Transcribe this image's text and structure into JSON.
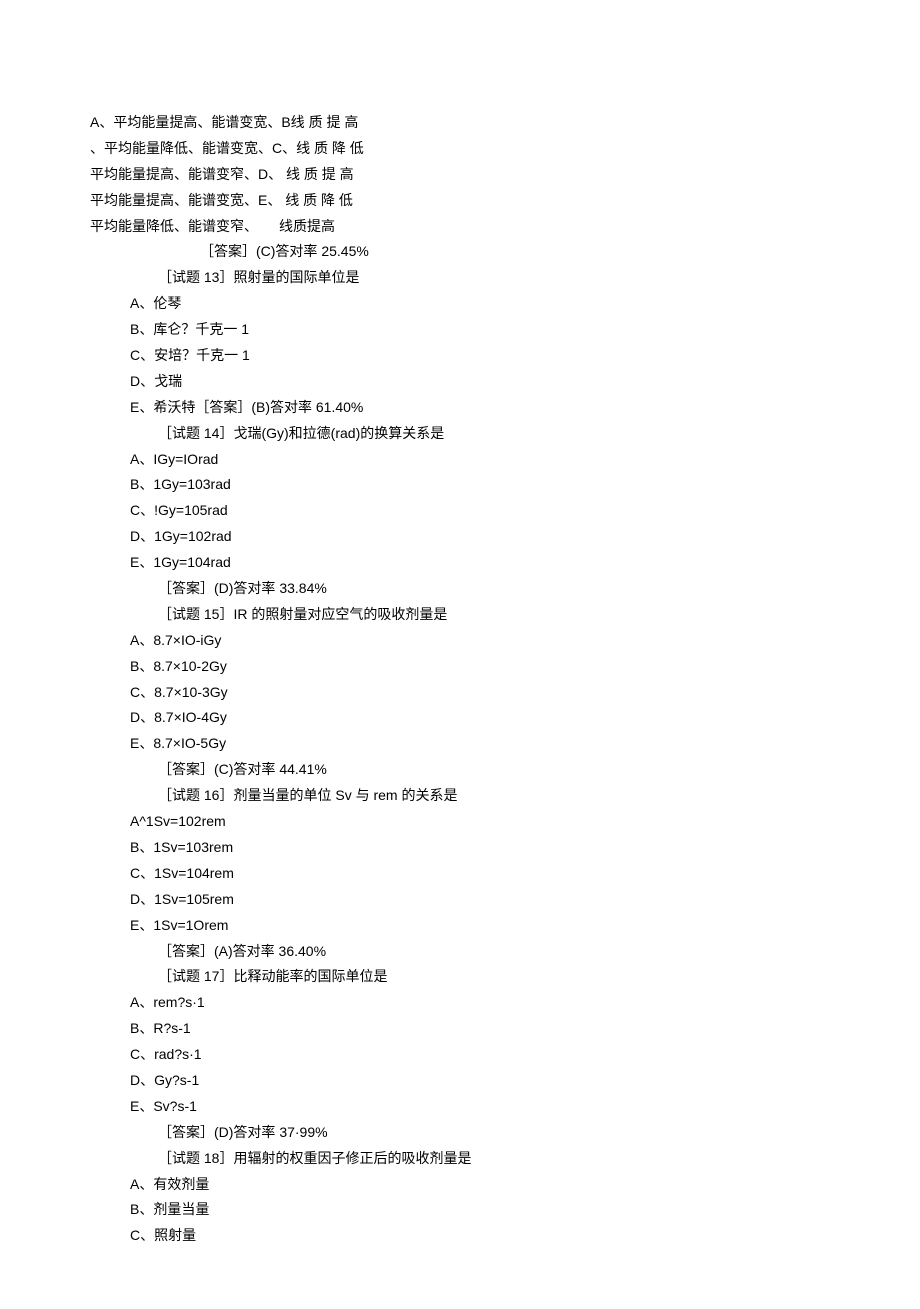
{
  "lines": [
    {
      "cls": "indent0",
      "text": "A、平均能量提高、能谱变宽、B线 质 提 高"
    },
    {
      "cls": "indent0",
      "text": "、平均能量降低、能谱变宽、C、线 质 降 低"
    },
    {
      "cls": "indent0",
      "text": "平均能量提高、能谱变窄、D、 线 质 提 高"
    },
    {
      "cls": "indent0",
      "text": "平均能量提高、能谱变宽、E、 线 质 降 低"
    },
    {
      "cls": "indent0",
      "text": "平均能量降低、能谱变窄、　　线质提高"
    },
    {
      "cls": "indent3",
      "text": "［答案］(C)答对率 25.45%"
    },
    {
      "cls": "indent2",
      "text": "［试题 13］照射量的国际单位是"
    },
    {
      "cls": "indent1",
      "text": "A、伦琴"
    },
    {
      "cls": "indent1",
      "text": "B、库仑？千克一 1"
    },
    {
      "cls": "indent1",
      "text": "C、安培？千克一 1"
    },
    {
      "cls": "indent1",
      "text": "D、戈瑞"
    },
    {
      "cls": "indent1",
      "text": "E、希沃特［答案］(B)答对率 61.40%"
    },
    {
      "cls": "indent2",
      "text": "［试题 14］戈瑞(Gy)和拉德(rad)的换算关系是"
    },
    {
      "cls": "indent1",
      "text": "A、IGy=IOrad"
    },
    {
      "cls": "indent1",
      "text": "B、1Gy=103rad"
    },
    {
      "cls": "indent1",
      "text": "C、!Gy=105rad"
    },
    {
      "cls": "indent1",
      "text": "D、1Gy=102rad"
    },
    {
      "cls": "indent1",
      "text": "E、1Gy=104rad"
    },
    {
      "cls": "indent2",
      "text": "［答案］(D)答对率 33.84%"
    },
    {
      "cls": "indent2",
      "text": "［试题 15］IR 的照射量对应空气的吸收剂量是"
    },
    {
      "cls": "indent1",
      "text": "A、8.7×IO-iGy"
    },
    {
      "cls": "indent1",
      "text": "B、8.7×10-2Gy"
    },
    {
      "cls": "indent1",
      "text": "C、8.7×10-3Gy"
    },
    {
      "cls": "indent1",
      "text": "D、8.7×IO-4Gy"
    },
    {
      "cls": "indent1",
      "text": "E、8.7×IO-5Gy"
    },
    {
      "cls": "indent2",
      "text": "［答案］(C)答对率 44.41%"
    },
    {
      "cls": "indent2",
      "text": "［试题 16］剂量当量的单位 Sv 与 rem 的关系是"
    },
    {
      "cls": "indent1",
      "text": "A^1Sv=102rem"
    },
    {
      "cls": "indent1",
      "text": "B、1Sv=103rem"
    },
    {
      "cls": "indent1",
      "text": "C、1Sv=104rem"
    },
    {
      "cls": "indent1",
      "text": "D、1Sv=105rem"
    },
    {
      "cls": "indent1",
      "text": "E、1Sv=1Orem"
    },
    {
      "cls": "indent2",
      "text": "［答案］(A)答对率 36.40%"
    },
    {
      "cls": "indent2",
      "text": "［试题 17］比释动能率的国际单位是"
    },
    {
      "cls": "indent1",
      "text": "A、rem?s·1"
    },
    {
      "cls": "indent1",
      "text": "B、R?s-1"
    },
    {
      "cls": "indent1",
      "text": "C、rad?s·1"
    },
    {
      "cls": "indent1",
      "text": "D、Gy?s-1"
    },
    {
      "cls": "indent1",
      "text": "E、Sv?s-1"
    },
    {
      "cls": "indent2",
      "text": "［答案］(D)答对率 37·99%"
    },
    {
      "cls": "indent2",
      "text": "［试题 18］用辐射的权重因子修正后的吸收剂量是"
    },
    {
      "cls": "indent1",
      "text": "A、有效剂量"
    },
    {
      "cls": "indent1",
      "text": "B、剂量当量"
    },
    {
      "cls": "indent1",
      "text": "C、照射量"
    }
  ]
}
